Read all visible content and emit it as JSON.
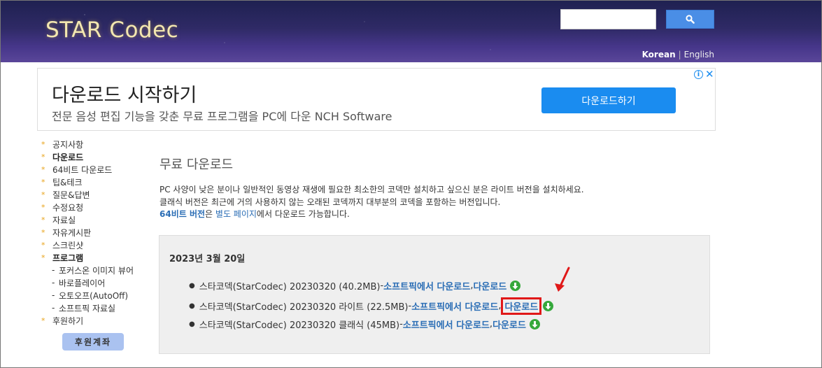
{
  "header": {
    "logo": "STAR Codec",
    "search": {
      "value": "",
      "placeholder": ""
    },
    "lang": {
      "current": "Korean",
      "separator": "|",
      "alternate": "English"
    }
  },
  "ad": {
    "title": "다운로드 시작하기",
    "subtitle": "전문 음성 편집 기능을 갖춘 무료 프로그램을 PC에 다운 NCH Software",
    "button": "다운로드하기",
    "info": "i",
    "close": "✕"
  },
  "sidebar": {
    "items": [
      {
        "label": "공지사항"
      },
      {
        "label": "다운로드"
      },
      {
        "label": "64비트 다운로드"
      },
      {
        "label": "팁&테크"
      },
      {
        "label": "질문&답변"
      },
      {
        "label": "수정요청"
      },
      {
        "label": "자료실"
      },
      {
        "label": "자유게시판"
      },
      {
        "label": "스크린샷"
      },
      {
        "label": "프로그램"
      }
    ],
    "sub_items": [
      {
        "label": "포커스온 이미지 뷰어"
      },
      {
        "label": "바로플레이어"
      },
      {
        "label": "오토오프(AutoOff)"
      },
      {
        "label": "소프트픽 자료실"
      }
    ],
    "last_item": {
      "label": "후원하기"
    },
    "donate_button": "후원계좌"
  },
  "main": {
    "title": "무료 다운로드",
    "desc_line1": "PC 사양이 낮은 분이나 일반적인 동영상 재생에 필요한 최소한의 코덱만 설치하고 싶으신 분은 라이트 버전을 설치하세요.",
    "desc_line2": "클래식 버전은 최근에 거의 사용하지 않는 오래된 코덱까지 대부분의 코덱을 포함하는 버전입니다.",
    "desc_line3_link1": "64비트 버전",
    "desc_line3_mid": "은 ",
    "desc_line3_link2": "별도 페이지",
    "desc_line3_end": "에서 다운로드 가능합니다.",
    "release_date": "2023년 3월 20일",
    "downloads": [
      {
        "name": "스타코덱(StarCodec) 20230320 (40.2MB)",
        "dash": " - ",
        "link1": "소프트픽에서 다운로드",
        "comma": ", ",
        "link2": "다운로드"
      },
      {
        "name": "스타코덱(StarCodec) 20230320 라이트 (22.5MB)",
        "dash": " - ",
        "link1": "소프트픽에서 다운로드",
        "comma": ",",
        "link2": "다운로드"
      },
      {
        "name": "스타코덱(StarCodec) 20230320 클래식 (45MB)",
        "dash": " - ",
        "link1": "소프트픽에서 다운로드",
        "comma": ", ",
        "link2": "다운로드"
      }
    ]
  },
  "colors": {
    "link": "#2a6db5",
    "accent": "#e8a31a",
    "highlight": "#e01818",
    "download_icon": "#35a83b"
  }
}
